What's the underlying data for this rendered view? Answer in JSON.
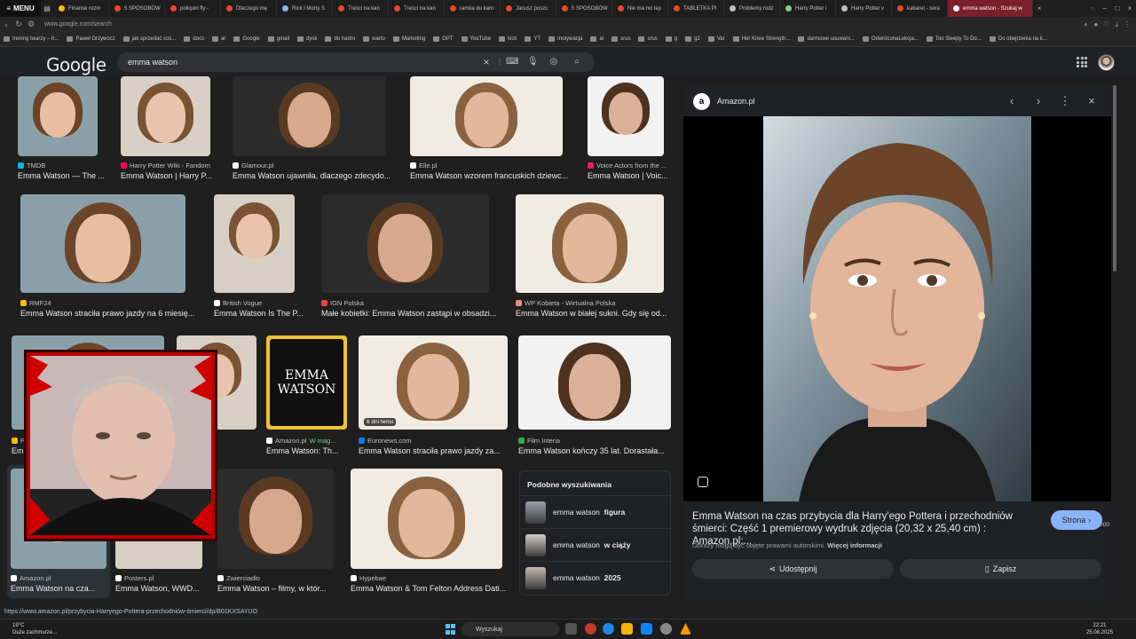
{
  "browser": {
    "menu_label": "MENU",
    "tabs": [
      {
        "label": "Finanse rozm",
        "color": "#fbbc04"
      },
      {
        "label": "5 SPOSOBÓW",
        "color": "#ea4335"
      },
      {
        "label": "poliquin fly -",
        "color": "#ea4335"
      },
      {
        "label": "Dlaczego mę",
        "color": "#ea4335"
      },
      {
        "label": "Rick i Morty S",
        "color": "#8ab4f8"
      },
      {
        "label": "Treści na kan",
        "color": "#ea4335"
      },
      {
        "label": "Treści na kan",
        "color": "#ea4335"
      },
      {
        "label": "ramka do kam",
        "color": "#ea4335"
      },
      {
        "label": "Janusz poszc",
        "color": "#ea4335"
      },
      {
        "label": "5 SPOSOBÓW",
        "color": "#ea4335"
      },
      {
        "label": "Nie ma nic lep",
        "color": "#ea4335"
      },
      {
        "label": "TABLETKA PI",
        "color": "#ea4335"
      },
      {
        "label": "Problemy rodz",
        "color": "#bdc1c6"
      },
      {
        "label": "Harry Potter i",
        "color": "#81c995"
      },
      {
        "label": "Harry Potter v",
        "color": "#bdc1c6"
      },
      {
        "label": "kabaret - sera",
        "color": "#ea4335"
      }
    ],
    "active_tab": "emma watson - Szukaj w",
    "url": "www.google.com/search",
    "bookmarks": [
      "trening twarzy – h...",
      "Paweł Grzywocz",
      "jak sprzedać coś...",
      "docs",
      "ar",
      "Google",
      "gmail",
      "dysk",
      "do nadro",
      "warto",
      "Marketing",
      "GPT",
      "YouTube",
      "kick",
      "YT",
      "motywacja",
      "ai",
      "srus",
      "srus",
      "g",
      "g2",
      "Var",
      "Her Knee Strength...",
      "darmowe usuwani...",
      "OdwróconaLekcja...",
      "Too Sleepy To Do...",
      "Do obejrzenia na k..."
    ]
  },
  "google": {
    "logo": "Google",
    "query": "emma watson"
  },
  "results": {
    "row1": [
      {
        "source": "TMDB",
        "title": "Emma Watson — The ...",
        "fav": "#01b4e4"
      },
      {
        "source": "Harry Potter Wiki - Fandom",
        "title": "Emma Watson | Harry P...",
        "fav": "#fa005a"
      },
      {
        "source": "Glamour.pl",
        "title": "Emma Watson ujawniła, dlaczego zdecydo...",
        "fav": "#ffffff"
      },
      {
        "source": "Elle.pl",
        "title": "Emma Watson wzorem francuskich dziewc...",
        "fav": "#ffffff"
      },
      {
        "source": "Voice Actors from the ...",
        "title": "Emma Watson | Voic...",
        "fav": "#e91e63"
      }
    ],
    "row2": [
      {
        "source": "RMF24",
        "title": "Emma Watson straciła prawo jazdy na 6 miesię...",
        "fav": "#fbbc04"
      },
      {
        "source": "British Vogue",
        "title": "Emma Watson Is The P...",
        "fav": "#ffffff"
      },
      {
        "source": "IGN Polska",
        "title": "Małe kobietki: Emma Watson zastąpi w obsadzi...",
        "fav": "#ea4335"
      },
      {
        "source": "WP Kobieta - Wirtualna Polska",
        "title": "Emma Watson w białej sukni. Gdy się od...",
        "fav": "#f28b82"
      }
    ],
    "row3": [
      {
        "source": "Pl",
        "title": "Emm",
        "fav": "#fbbc04"
      },
      {
        "source": "er",
        "title": "son - Ac...",
        "fav": "#ffffff"
      },
      {
        "source": "Amazon.pl",
        "source_extra": "W mag...",
        "title": "Emma Watson: Th...",
        "fav": "#ffffff"
      },
      {
        "source": "Euronews.com",
        "title": "Emma Watson straciła prawo jazdy za...",
        "fav": "#1a73e8",
        "badge": "6 dni temu"
      },
      {
        "source": "Film Interia",
        "title": "Emma Watson kończy 35 lat. Dorastała...",
        "fav": "#34a853"
      }
    ],
    "row4": [
      {
        "source": "Amazon.pl",
        "title": "Emma Watson na cza...",
        "fav": "#ffffff"
      },
      {
        "source": "Posters.pl",
        "title": "Emma Watson, WWD...",
        "fav": "#ffffff"
      },
      {
        "source": "Zwierciadło",
        "title": "Emma Watson – filmy, w któr...",
        "fav": "#ffffff"
      },
      {
        "source": "Hypebae",
        "title": "Emma Watson & Tom Felton Address Dati...",
        "fav": "#ffffff"
      }
    ],
    "book_cover": [
      "EMMA",
      "WATSON"
    ]
  },
  "related": {
    "title": "Podobne wyszukiwania",
    "items": [
      {
        "prefix": "emma watson ",
        "bold": "figura"
      },
      {
        "prefix": "emma watson ",
        "bold": "w ciąży"
      },
      {
        "prefix": "emma watson ",
        "bold": "2025"
      }
    ]
  },
  "preview": {
    "source_letter": "a",
    "source": "Amazon.pl",
    "dimensions": "694 × 1 000",
    "title": "Emma Watson na czas przybycia dla Harry'ego Pottera i przechodniów śmierci: Część 1 premierowy wydruk zdjęcia (20,32 x 25,40 cm) : Amazon.pl:...",
    "visit_label": "Strona",
    "copyright": "Obrazy mogą być objęte prawami autorskimi.",
    "copyright_link": "Więcej informacji",
    "share_label": "Udostępnij",
    "save_label": "Zapisz"
  },
  "status_url": "https://www.amazon.pl/przybycia-Harryego-Pottera-przechodniów-śmierci/dp/B01KXSAYUO",
  "taskbar": {
    "weather_temp": "19°C",
    "weather_desc": "Duże zachmurze...",
    "search_label": "Wyszukaj",
    "time": "22:21",
    "date": "25.08.2025"
  }
}
